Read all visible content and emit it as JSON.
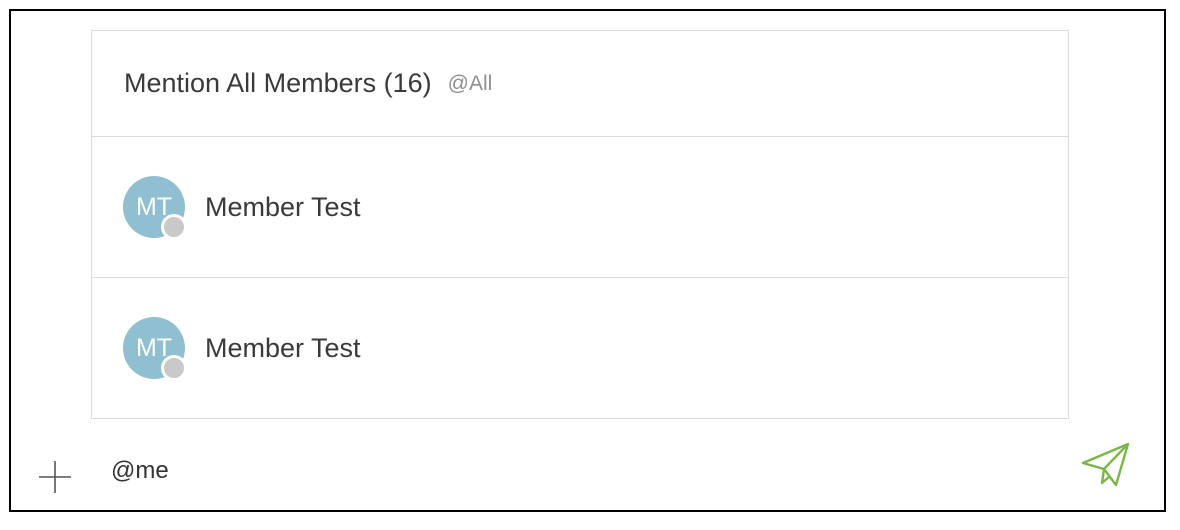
{
  "mention_popup": {
    "mention_all": {
      "label": "Mention All Members (16)",
      "handle": "@All"
    },
    "members": [
      {
        "initials": "MT",
        "name": "Member Test",
        "presence": "offline"
      },
      {
        "initials": "MT",
        "name": "Member Test",
        "presence": "offline"
      }
    ]
  },
  "composer": {
    "value": "@me",
    "add_icon": "plus-icon",
    "send_icon": "send-icon"
  },
  "colors": {
    "avatar": "#8fbfd0",
    "presence_offline": "#c9c9c9",
    "send_accent": "#7ab648",
    "border": "#dcdcdc"
  }
}
